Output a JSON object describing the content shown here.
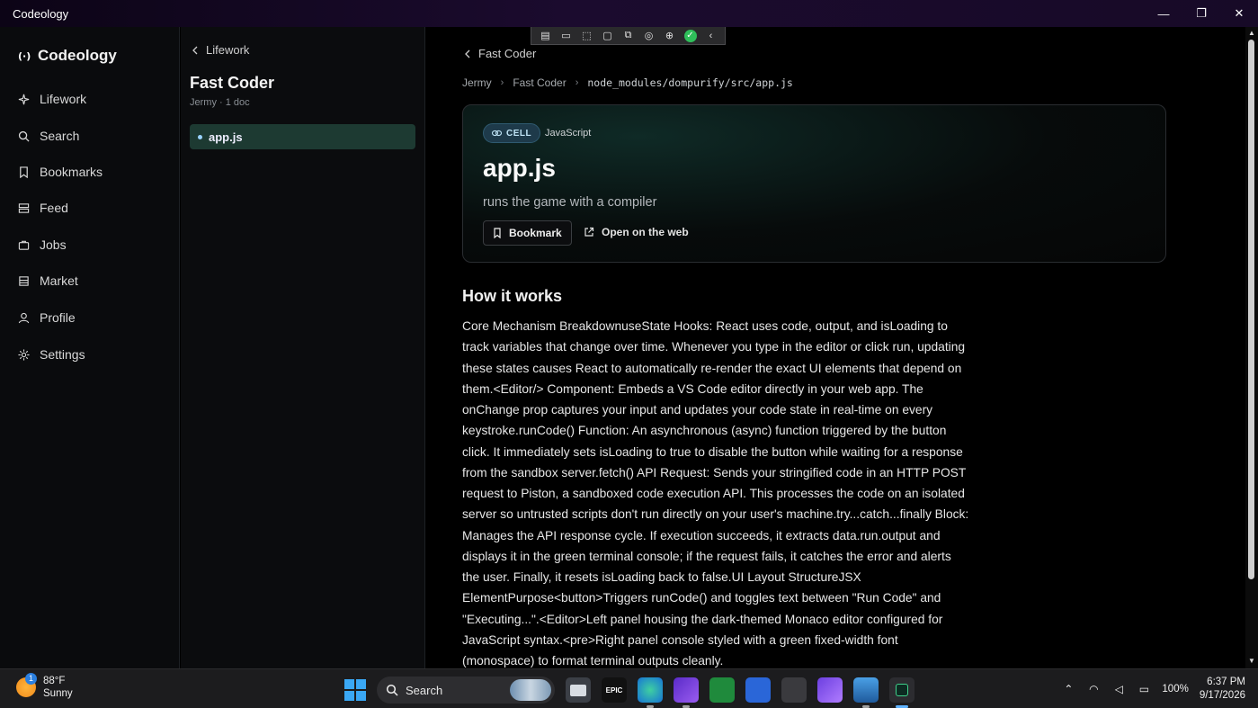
{
  "window": {
    "title": "Codeology",
    "minimize": "—",
    "restore": "❐",
    "close": "✕"
  },
  "sidebar": {
    "brand": "Codeology",
    "items": [
      {
        "label": "Lifework",
        "icon": "sparkle-icon"
      },
      {
        "label": "Search",
        "icon": "search-icon"
      },
      {
        "label": "Bookmarks",
        "icon": "bookmark-icon"
      },
      {
        "label": "Feed",
        "icon": "feed-icon"
      },
      {
        "label": "Jobs",
        "icon": "briefcase-icon"
      },
      {
        "label": "Market",
        "icon": "store-icon"
      },
      {
        "label": "Profile",
        "icon": "user-icon"
      },
      {
        "label": "Settings",
        "icon": "gear-icon"
      }
    ]
  },
  "midpanel": {
    "back_label": "Lifework",
    "title": "Fast Coder",
    "subtitle": "Jermy · 1 doc",
    "doc_item": "app.js"
  },
  "main": {
    "back_label": "Fast Coder",
    "breadcrumb": [
      "Jermy",
      "Fast Coder",
      "node_modules/dompurify/src/app.js"
    ],
    "card": {
      "badge": "CELL",
      "language": "JavaScript",
      "title": "app.js",
      "description": "runs the game with a compiler",
      "bookmark_label": "Bookmark",
      "open_web_label": "Open on the web"
    },
    "section_title": "How it works",
    "body": "Core Mechanism BreakdownuseState Hooks: React uses code, output, and isLoading to track variables that change over time. Whenever you type in the editor or click run, updating these states causes React to automatically re-render the exact UI elements that depend on them.<Editor/> Component: Embeds a VS Code editor directly in your web app. The onChange prop captures your input and updates your code state in real-time on every keystroke.runCode() Function: An asynchronous (async) function triggered by the button click. It immediately sets isLoading to true to disable the button while waiting for a response from the sandbox server.fetch() API Request: Sends your stringified code in an HTTP POST request to Piston, a sandboxed code execution API. This processes the code on an isolated server so untrusted scripts don't run directly on your user's machine.try...catch...finally Block: Manages the API response cycle. If execution succeeds, it extracts data.run.output and displays it in the green terminal console; if the request fails, it catches the error and alerts the user. Finally, it resets isLoading back to false.UI Layout StructureJSX ElementPurpose<button>Triggers runCode() and toggles text between \"Run Code\" and \"Executing...\".<Editor>Left panel housing the dark-themed Monaco editor configured for JavaScript syntax.<pre>Right panel console styled with a green fixed-width font (monospace) to format terminal outputs cleanly."
  },
  "taskbar": {
    "weather_temp": "88°F",
    "weather_desc": "Sunny",
    "weather_badge": "1",
    "search_label": "Search",
    "battery": "100%",
    "time": "6:37 PM",
    "date": "9/17/2026",
    "epic_label": "EPIC"
  },
  "colors": {
    "accent": "#1d3a32",
    "cell_badge": "#1e3a4a",
    "check_green": "#2fbf5a"
  }
}
